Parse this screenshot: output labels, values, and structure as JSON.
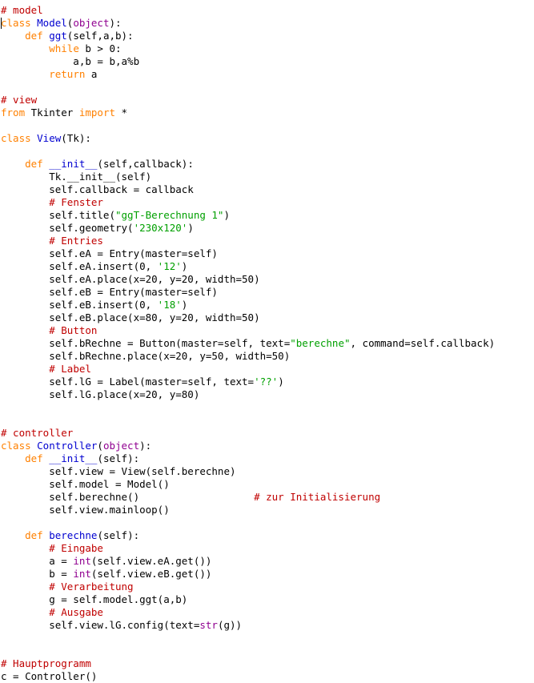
{
  "editor": {
    "language": "Python",
    "background_color": "#ffffff",
    "caret": {
      "line": 2,
      "column": 0,
      "visible": true
    },
    "colors": {
      "keyword": "#ff8000",
      "definition": "#0000d0",
      "builtin": "#900090",
      "string": "#00a000",
      "comment": "#c00000",
      "plain": "#000000"
    }
  },
  "code": {
    "lines": [
      [
        {
          "t": "# model",
          "c": "com"
        }
      ],
      [
        {
          "t": "class ",
          "c": "kw"
        },
        {
          "t": "Model",
          "c": "def"
        },
        {
          "t": "(",
          "c": "plain"
        },
        {
          "t": "object",
          "c": "builtin"
        },
        {
          "t": "):",
          "c": "plain"
        }
      ],
      [
        {
          "t": "    ",
          "c": "plain"
        },
        {
          "t": "def ",
          "c": "kw"
        },
        {
          "t": "ggt",
          "c": "def"
        },
        {
          "t": "(self,a,b):",
          "c": "plain"
        }
      ],
      [
        {
          "t": "        ",
          "c": "plain"
        },
        {
          "t": "while ",
          "c": "kw"
        },
        {
          "t": "b > 0:",
          "c": "plain"
        }
      ],
      [
        {
          "t": "            a,b = b,a%b",
          "c": "plain"
        }
      ],
      [
        {
          "t": "        ",
          "c": "plain"
        },
        {
          "t": "return ",
          "c": "kw"
        },
        {
          "t": "a",
          "c": "plain"
        }
      ],
      [],
      [
        {
          "t": "# view",
          "c": "com"
        }
      ],
      [
        {
          "t": "from ",
          "c": "kw"
        },
        {
          "t": "Tkinter ",
          "c": "plain"
        },
        {
          "t": "import ",
          "c": "kw"
        },
        {
          "t": "*",
          "c": "plain"
        }
      ],
      [],
      [
        {
          "t": "class ",
          "c": "kw"
        },
        {
          "t": "View",
          "c": "def"
        },
        {
          "t": "(Tk):",
          "c": "plain"
        }
      ],
      [],
      [
        {
          "t": "    ",
          "c": "plain"
        },
        {
          "t": "def ",
          "c": "kw"
        },
        {
          "t": "__init__",
          "c": "def"
        },
        {
          "t": "(self,callback):",
          "c": "plain"
        }
      ],
      [
        {
          "t": "        Tk.__init__(self)",
          "c": "plain"
        }
      ],
      [
        {
          "t": "        self.callback = callback",
          "c": "plain"
        }
      ],
      [
        {
          "t": "        ",
          "c": "plain"
        },
        {
          "t": "# Fenster",
          "c": "com"
        }
      ],
      [
        {
          "t": "        self.title(",
          "c": "plain"
        },
        {
          "t": "\"ggT-Berechnung 1\"",
          "c": "str"
        },
        {
          "t": ")",
          "c": "plain"
        }
      ],
      [
        {
          "t": "        self.geometry(",
          "c": "plain"
        },
        {
          "t": "'230x120'",
          "c": "str"
        },
        {
          "t": ")",
          "c": "plain"
        }
      ],
      [
        {
          "t": "        ",
          "c": "plain"
        },
        {
          "t": "# Entries",
          "c": "com"
        }
      ],
      [
        {
          "t": "        self.eA = Entry(master=self)",
          "c": "plain"
        }
      ],
      [
        {
          "t": "        self.eA.insert(0, ",
          "c": "plain"
        },
        {
          "t": "'12'",
          "c": "str"
        },
        {
          "t": ")",
          "c": "plain"
        }
      ],
      [
        {
          "t": "        self.eA.place(x=20, y=20, width=50)",
          "c": "plain"
        }
      ],
      [
        {
          "t": "        self.eB = Entry(master=self)",
          "c": "plain"
        }
      ],
      [
        {
          "t": "        self.eB.insert(0, ",
          "c": "plain"
        },
        {
          "t": "'18'",
          "c": "str"
        },
        {
          "t": ")",
          "c": "plain"
        }
      ],
      [
        {
          "t": "        self.eB.place(x=80, y=20, width=50)",
          "c": "plain"
        }
      ],
      [
        {
          "t": "        ",
          "c": "plain"
        },
        {
          "t": "# Button",
          "c": "com"
        }
      ],
      [
        {
          "t": "        self.bRechne = Button(master=self, text=",
          "c": "plain"
        },
        {
          "t": "\"berechne\"",
          "c": "str"
        },
        {
          "t": ", command=self.callback)",
          "c": "plain"
        }
      ],
      [
        {
          "t": "        self.bRechne.place(x=20, y=50, width=50)",
          "c": "plain"
        }
      ],
      [
        {
          "t": "        ",
          "c": "plain"
        },
        {
          "t": "# Label",
          "c": "com"
        }
      ],
      [
        {
          "t": "        self.lG = Label(master=self, text=",
          "c": "plain"
        },
        {
          "t": "'??'",
          "c": "str"
        },
        {
          "t": ")",
          "c": "plain"
        }
      ],
      [
        {
          "t": "        self.lG.place(x=20, y=80)",
          "c": "plain"
        }
      ],
      [],
      [],
      [
        {
          "t": "# controller",
          "c": "com"
        }
      ],
      [
        {
          "t": "class ",
          "c": "kw"
        },
        {
          "t": "Controller",
          "c": "def"
        },
        {
          "t": "(",
          "c": "plain"
        },
        {
          "t": "object",
          "c": "builtin"
        },
        {
          "t": "):",
          "c": "plain"
        }
      ],
      [
        {
          "t": "    ",
          "c": "plain"
        },
        {
          "t": "def ",
          "c": "kw"
        },
        {
          "t": "__init__",
          "c": "def"
        },
        {
          "t": "(self):",
          "c": "plain"
        }
      ],
      [
        {
          "t": "        self.view = View(self.berechne)",
          "c": "plain"
        }
      ],
      [
        {
          "t": "        self.model = Model()",
          "c": "plain"
        }
      ],
      [
        {
          "t": "        self.berechne()                   ",
          "c": "plain"
        },
        {
          "t": "# zur Initialisierung",
          "c": "com"
        }
      ],
      [
        {
          "t": "        self.view.mainloop()",
          "c": "plain"
        }
      ],
      [],
      [
        {
          "t": "    ",
          "c": "plain"
        },
        {
          "t": "def ",
          "c": "kw"
        },
        {
          "t": "berechne",
          "c": "def"
        },
        {
          "t": "(self):",
          "c": "plain"
        }
      ],
      [
        {
          "t": "        ",
          "c": "plain"
        },
        {
          "t": "# Eingabe",
          "c": "com"
        }
      ],
      [
        {
          "t": "        a = ",
          "c": "plain"
        },
        {
          "t": "int",
          "c": "builtin"
        },
        {
          "t": "(self.view.eA.get())",
          "c": "plain"
        }
      ],
      [
        {
          "t": "        b = ",
          "c": "plain"
        },
        {
          "t": "int",
          "c": "builtin"
        },
        {
          "t": "(self.view.eB.get())",
          "c": "plain"
        }
      ],
      [
        {
          "t": "        ",
          "c": "plain"
        },
        {
          "t": "# Verarbeitung",
          "c": "com"
        }
      ],
      [
        {
          "t": "        g = self.model.ggt(a,b)",
          "c": "plain"
        }
      ],
      [
        {
          "t": "        ",
          "c": "plain"
        },
        {
          "t": "# Ausgabe",
          "c": "com"
        }
      ],
      [
        {
          "t": "        self.view.lG.config(text=",
          "c": "plain"
        },
        {
          "t": "str",
          "c": "builtin"
        },
        {
          "t": "(g))",
          "c": "plain"
        }
      ],
      [],
      [],
      [
        {
          "t": "# Hauptprogramm",
          "c": "com"
        }
      ],
      [
        {
          "t": "c = Controller()",
          "c": "plain"
        }
      ]
    ]
  }
}
